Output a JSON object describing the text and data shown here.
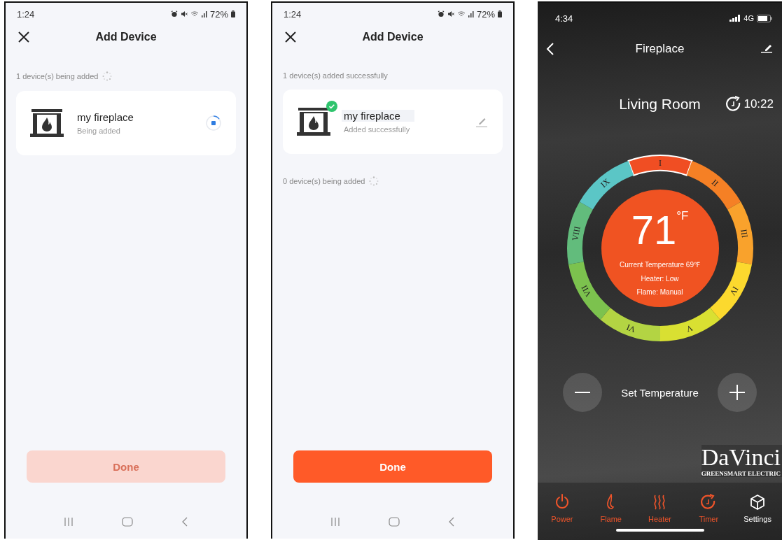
{
  "screens": [
    {
      "kind": "add_device",
      "status_bar": {
        "time": "1:24",
        "battery": "72%"
      },
      "title": "Add Device",
      "sections": [
        {
          "kind": "status",
          "text": "1 device(s) being added",
          "spinner": true
        },
        {
          "kind": "device",
          "name": "my fireplace",
          "status": "Being added",
          "added": false
        }
      ],
      "done_button": {
        "label": "Done",
        "disabled": true
      }
    },
    {
      "kind": "add_device",
      "status_bar": {
        "time": "1:24",
        "battery": "72%"
      },
      "title": "Add Device",
      "sections": [
        {
          "kind": "status",
          "text": "1 device(s) added successfully",
          "spinner": false
        },
        {
          "kind": "device",
          "name": "my fireplace",
          "status": "Added successfully",
          "added": true
        },
        {
          "kind": "status",
          "text": "0 device(s) being added",
          "spinner": true
        }
      ],
      "done_button": {
        "label": "Done",
        "disabled": false
      }
    },
    {
      "kind": "fireplace",
      "status_bar": {
        "time": "4:34",
        "network": "4G"
      },
      "title": "Fireplace",
      "room": "Living Room",
      "timer": "10:22",
      "dial": {
        "temperature": "71",
        "unit": "°F",
        "info": [
          "Current Temperature 69℉",
          "Heater: Low",
          "Flame: Manual"
        ],
        "segments": [
          {
            "label": "I",
            "color": "#f04e23",
            "selected": true
          },
          {
            "label": "II",
            "color": "#f58025",
            "selected": false
          },
          {
            "label": "III",
            "color": "#f9a22c",
            "selected": false
          },
          {
            "label": "IV",
            "color": "#fcd92e",
            "selected": false
          },
          {
            "label": "V",
            "color": "#d9e032",
            "selected": false
          },
          {
            "label": "VI",
            "color": "#b3d443",
            "selected": false
          },
          {
            "label": "VII",
            "color": "#7cc24e",
            "selected": false
          },
          {
            "label": "VIII",
            "color": "#62bc7c",
            "selected": false
          },
          {
            "label": "IX",
            "color": "#5bc6c6",
            "selected": false
          }
        ]
      },
      "set_label": "Set Temperature",
      "brand": {
        "name": "DaVinci",
        "tagline": "GREENSMART ELECTRIC"
      },
      "tabs": [
        {
          "kind": "power",
          "label": "Power",
          "on": true
        },
        {
          "kind": "flame",
          "label": "Flame",
          "on": true
        },
        {
          "kind": "heater",
          "label": "Heater",
          "on": true
        },
        {
          "kind": "timer",
          "label": "Timer",
          "on": true
        },
        {
          "kind": "settings",
          "label": "Settings",
          "on": false
        }
      ]
    }
  ]
}
